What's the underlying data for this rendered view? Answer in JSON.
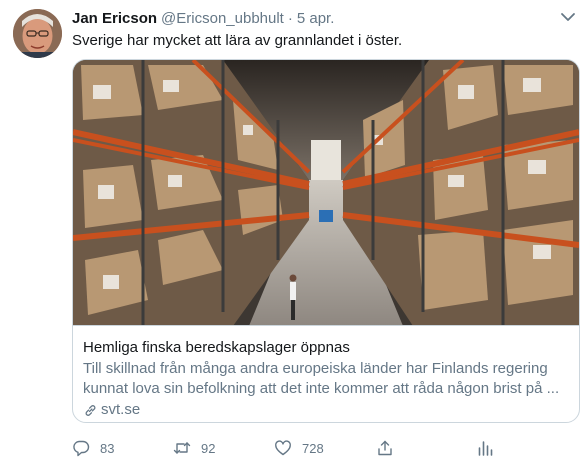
{
  "tweet": {
    "author_name": "Jan Ericson",
    "author_handle": "@Ericson_ubbhult",
    "separator": "·",
    "date": "5 apr.",
    "text": "Sverige har mycket att lära av grannlandet i öster."
  },
  "card": {
    "title": "Hemliga finska beredskapslager öppnas",
    "description_line1": "Till skillnad från många andra europeiska länder har Finlands regering",
    "description_line2": "kunnat lova sin befolkning att det inte kommer att råda någon brist på ...",
    "domain": "svt.se",
    "domain_icon": "link-icon"
  },
  "actions": {
    "reply_count": "83",
    "retweet_count": "92",
    "like_count": "728",
    "reply_icon": "reply-icon",
    "retweet_icon": "retweet-icon",
    "like_icon": "heart-icon",
    "share_icon": "share-icon",
    "analytics_icon": "analytics-icon"
  },
  "colors": {
    "text_primary": "#14171a",
    "text_secondary": "#657786",
    "border": "#ccd6dd",
    "shelf_orange": "#c8501e"
  }
}
